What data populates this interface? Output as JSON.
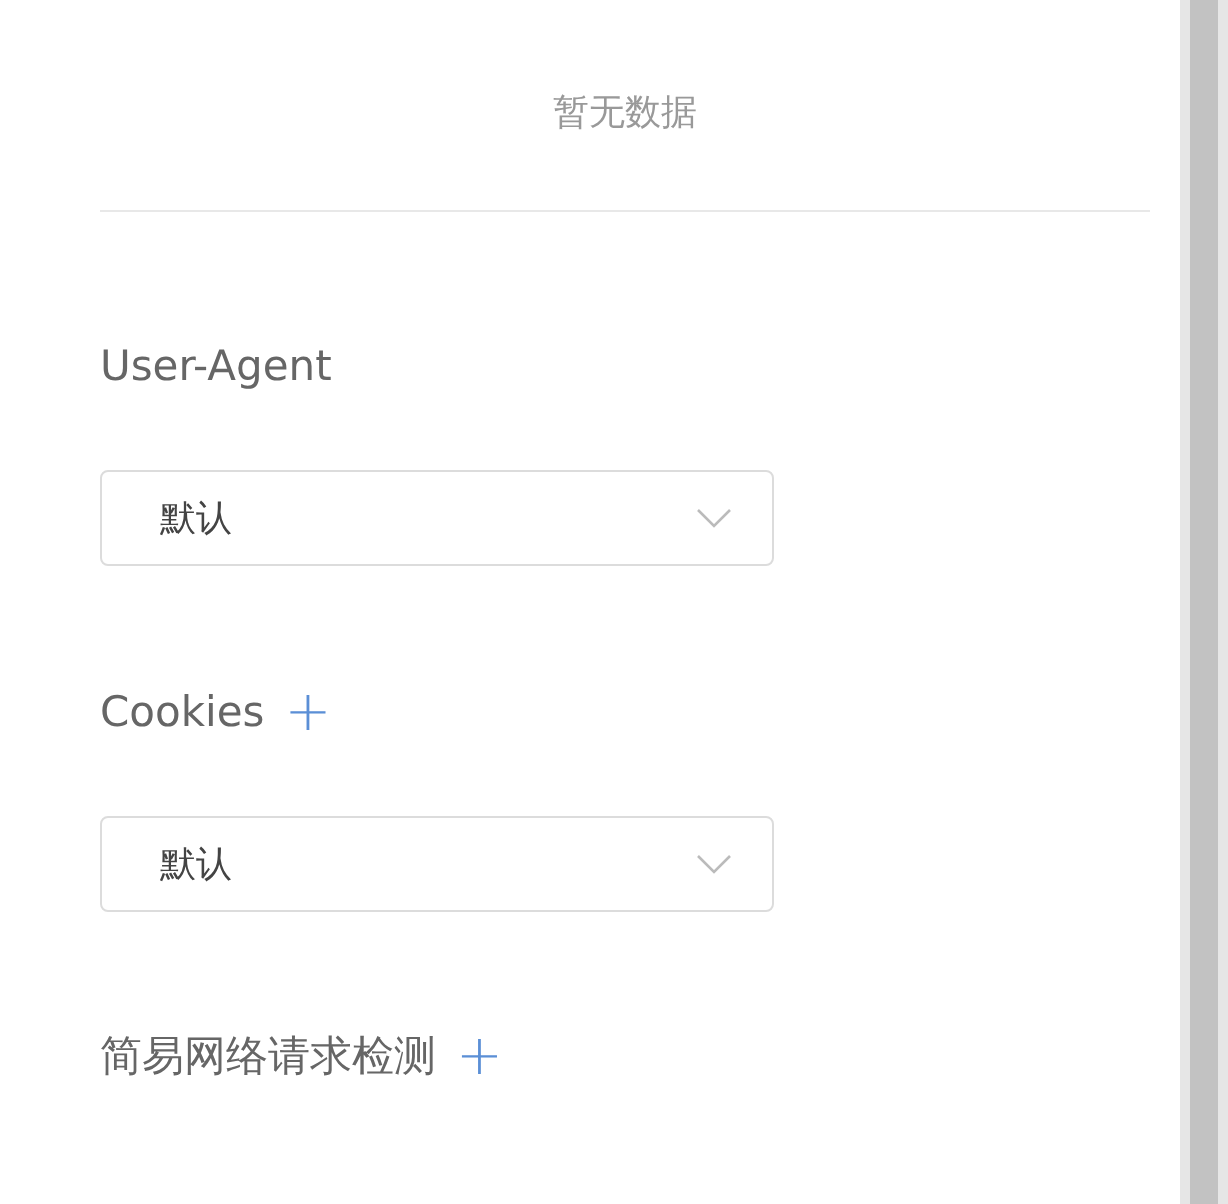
{
  "empty_state": {
    "text": "暂无数据"
  },
  "sections": [
    {
      "label": "User-Agent",
      "select": {
        "value": "默认"
      }
    },
    {
      "label": "Cookies",
      "add_icon": "+",
      "select": {
        "value": "默认"
      }
    },
    {
      "label": "简易网络请求检测",
      "add_icon": "+"
    }
  ]
}
